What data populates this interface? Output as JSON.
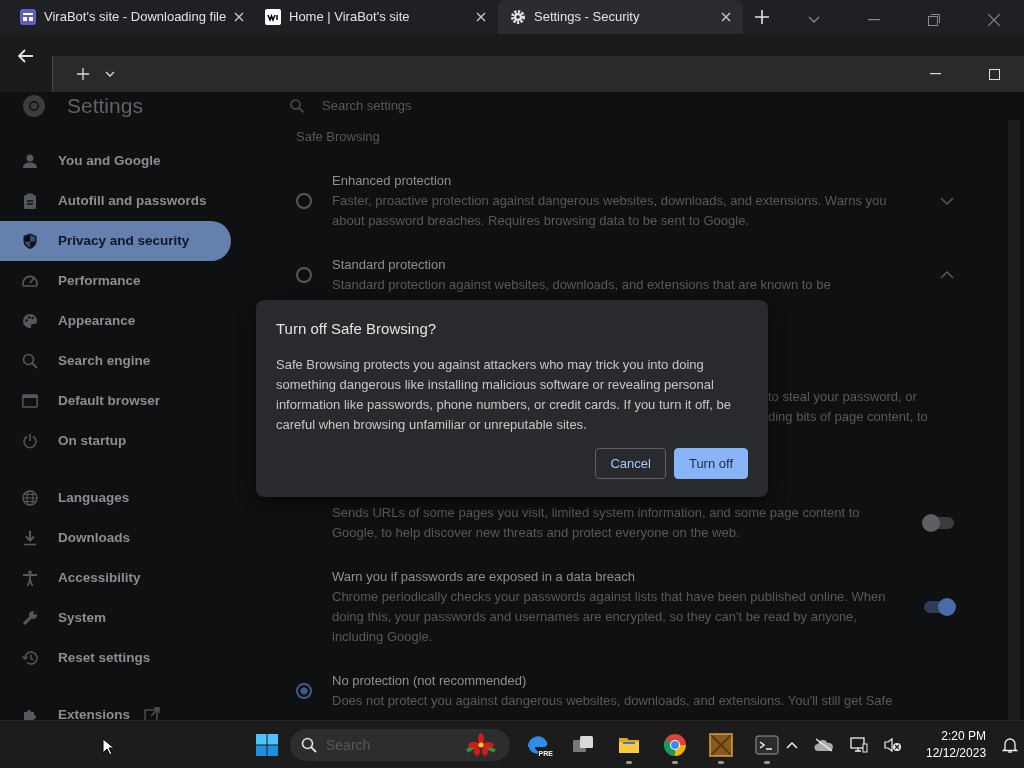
{
  "browser": {
    "tabs": [
      {
        "title": "ViraBot's site - Downloading file",
        "kind": "site",
        "selected": false
      },
      {
        "title": "Home | ViraBot's site",
        "kind": "wix",
        "selected": false
      },
      {
        "title": "Settings - Security",
        "kind": "settings",
        "selected": true
      }
    ]
  },
  "settings": {
    "title": "Settings",
    "search": {
      "placeholder": "Search settings"
    },
    "nav_groups": [
      {
        "items": [
          {
            "label": "You and Google",
            "kind": "person",
            "selected": false
          },
          {
            "label": "Autofill and passwords",
            "kind": "clipboard",
            "selected": false
          },
          {
            "label": "Privacy and security",
            "kind": "shield",
            "selected": true
          },
          {
            "label": "Performance",
            "kind": "gauge",
            "selected": false
          },
          {
            "label": "Appearance",
            "kind": "palette",
            "selected": false
          },
          {
            "label": "Search engine",
            "kind": "search",
            "selected": false
          },
          {
            "label": "Default browser",
            "kind": "browser",
            "selected": false
          },
          {
            "label": "On startup",
            "kind": "power",
            "selected": false
          }
        ]
      },
      {
        "items": [
          {
            "label": "Languages",
            "kind": "globe",
            "selected": false
          },
          {
            "label": "Downloads",
            "kind": "download",
            "selected": false
          },
          {
            "label": "Accessibility",
            "kind": "person-arms",
            "selected": false
          },
          {
            "label": "System",
            "kind": "wrench",
            "selected": false
          },
          {
            "label": "Reset settings",
            "kind": "history",
            "selected": false
          }
        ]
      },
      {
        "items": [
          {
            "label": "Extensions",
            "kind": "puzzle",
            "selected": false,
            "external": true
          }
        ]
      }
    ],
    "section_title": "Safe Browsing",
    "options": [
      {
        "kind": "radio",
        "title": "Enhanced protection",
        "description": "Faster, proactive protection against dangerous websites, downloads, and extensions. Warns you about password breaches. Requires browsing data to be sent to Google.",
        "selected": false,
        "expanded": false
      },
      {
        "kind": "radio",
        "title": "Standard protection",
        "description": "Standard protection against websites, downloads, and extensions that are known to be",
        "selected": false,
        "expanded": true
      },
      {
        "kind": "fragment",
        "lines": [
          "to steal your password, or",
          "ding bits of page content, to"
        ]
      },
      {
        "kind": "toggle",
        "description": "Sends URLs of some pages you visit, limited system information, and some page content to Google, to help discover new threats and protect everyone on the web.",
        "on": false
      },
      {
        "kind": "toggle",
        "title": "Warn you if passwords are exposed in a data breach",
        "description": "Chrome periodically checks your passwords against lists that have been published online. When doing this, your passwords and usernames are encrypted, so they can't be read by anyone, including Google.",
        "on": true
      },
      {
        "kind": "radio",
        "title": "No protection (not recommended)",
        "description": "Does not protect you against dangerous websites, downloads, and extensions. You'll still get Safe",
        "selected": true
      }
    ]
  },
  "dialog": {
    "title": "Turn off Safe Browsing?",
    "body": "Safe Browsing protects you against attackers who may trick you into doing something dangerous like installing malicious software or revealing personal information like passwords, phone numbers, or credit cards. If you turn it off, be careful when browsing unfamiliar or unreputable sites.",
    "buttons": [
      {
        "label": "Cancel",
        "kind": "secondary"
      },
      {
        "label": "Turn off",
        "kind": "primary"
      }
    ]
  },
  "taskbar": {
    "search": {
      "placeholder": "Search"
    },
    "apps": [
      {
        "kind": "edge",
        "badge": "PRE",
        "running": false
      },
      {
        "kind": "taskview",
        "running": false
      },
      {
        "kind": "folder",
        "running": true
      },
      {
        "kind": "chrome",
        "running": true
      },
      {
        "kind": "dos",
        "running": true
      },
      {
        "kind": "terminal",
        "running": true
      }
    ],
    "time": "2:20 PM",
    "date": "12/12/2023"
  }
}
